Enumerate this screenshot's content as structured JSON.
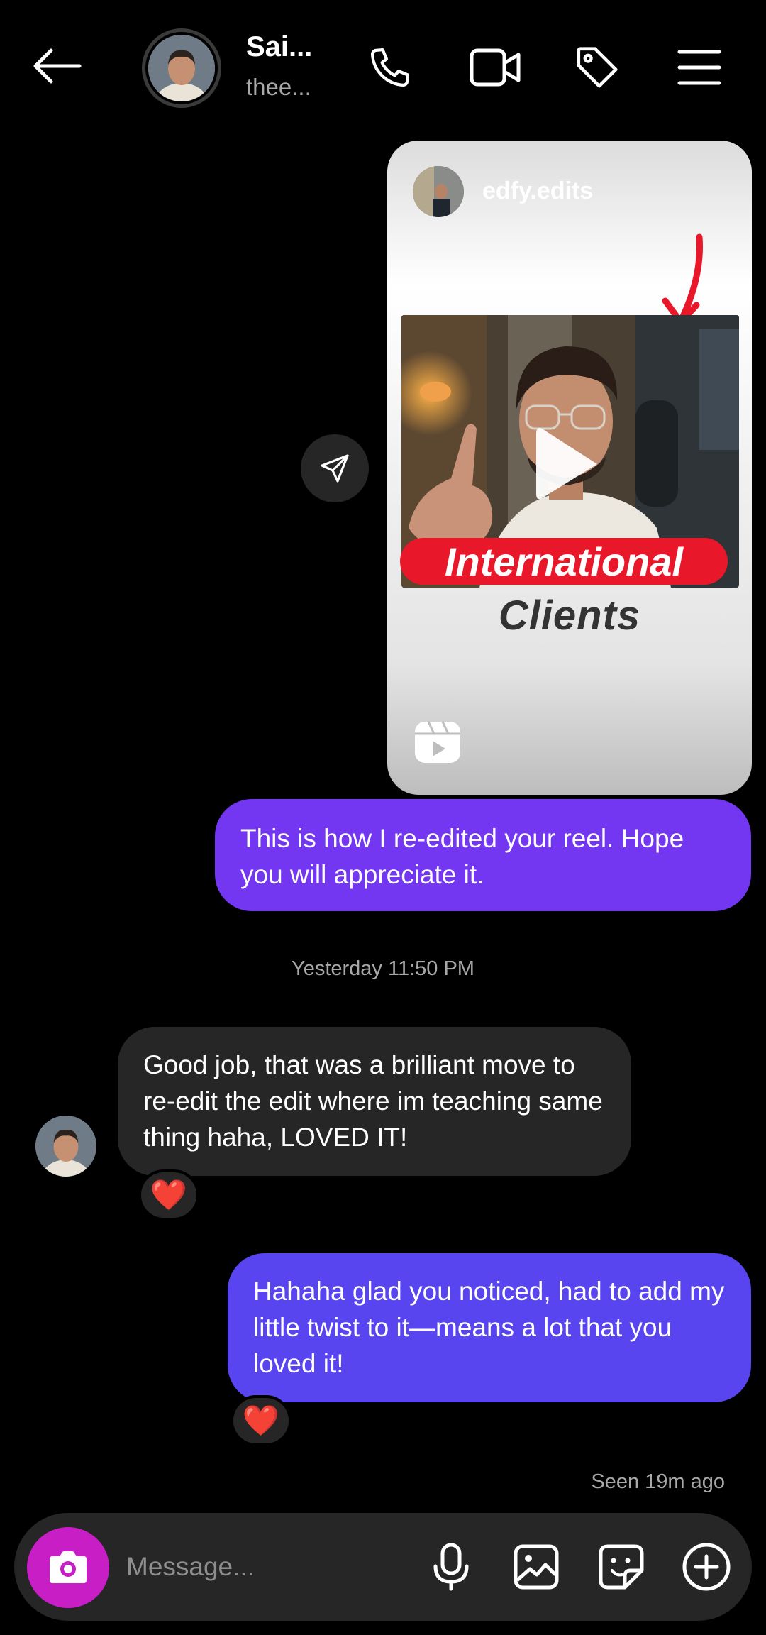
{
  "header": {
    "contact_name": "Sai...",
    "contact_username": "thee...",
    "icons": [
      "back-arrow-icon",
      "phone-icon",
      "video-call-icon",
      "tag-icon",
      "menu-icon"
    ]
  },
  "shared_reel": {
    "author": "edfy.edits",
    "caption_line1": "International",
    "caption_line2": "Clients",
    "icons": [
      "play-icon",
      "reels-icon",
      "forward-icon"
    ]
  },
  "messages": [
    {
      "direction": "outgoing",
      "text": "This is how I re-edited your reel. Hope you will appreciate it."
    },
    {
      "direction": "incoming",
      "text": "Good job, that was a brilliant move to re-edit the edit where im teaching same thing haha, LOVED IT!",
      "reaction": "❤️"
    },
    {
      "direction": "outgoing",
      "text": "Hahaha glad you noticed, had to add my little twist to it—means a lot that you loved it!",
      "reaction": "❤️"
    }
  ],
  "timestamp": "Yesterday 11:50 PM",
  "seen_status": "Seen 19m ago",
  "composer": {
    "placeholder": "Message...",
    "icons": [
      "camera-icon",
      "microphone-icon",
      "gallery-icon",
      "sticker-icon",
      "add-icon"
    ]
  },
  "colors": {
    "background": "#000000",
    "outgoing_bubble_1": "#7336f1",
    "outgoing_bubble_2": "#5845f0",
    "incoming_bubble": "#262626",
    "camera_button": "#c71fc5",
    "caption_red": "#e8182a",
    "secondary_text": "#a8a8a8"
  }
}
